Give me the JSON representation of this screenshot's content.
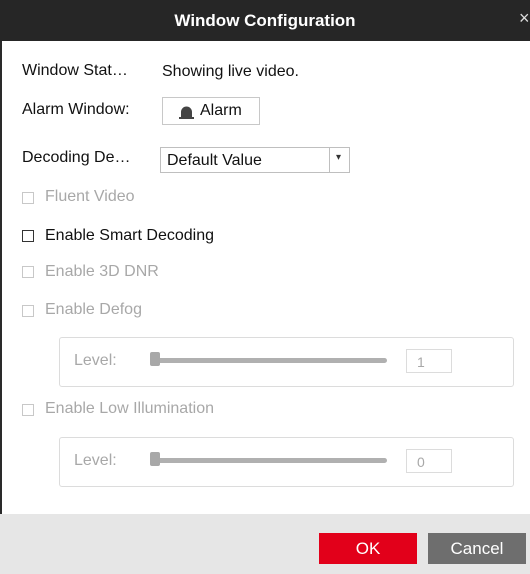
{
  "dialog": {
    "title": "Window Configuration",
    "close_symbol": "×"
  },
  "window_status": {
    "label": "Window Stat…",
    "value": "Showing live video."
  },
  "alarm_window": {
    "label": "Alarm Window:",
    "button_label": "Alarm",
    "icon": "alarm-light-icon"
  },
  "decoding": {
    "label": "Decoding De…",
    "selected": "Default Value",
    "arrow": "▾"
  },
  "options": {
    "fluent_video": {
      "label": "Fluent Video",
      "checked": false,
      "enabled": false
    },
    "smart_decoding": {
      "label": "Enable Smart Decoding",
      "checked": false,
      "enabled": true
    },
    "dnr_3d": {
      "label": "Enable 3D DNR",
      "checked": false,
      "enabled": false
    },
    "defog": {
      "label": "Enable Defog",
      "checked": false,
      "enabled": false
    },
    "low_illumination": {
      "label": "Enable Low Illumination",
      "checked": false,
      "enabled": false
    }
  },
  "defog_level": {
    "label": "Level:",
    "value": "1",
    "slider_fraction": 0.01
  },
  "low_illum_level": {
    "label": "Level:",
    "value": "0",
    "slider_fraction": 0.0
  },
  "footer": {
    "ok_label": "OK",
    "cancel_label": "Cancel"
  },
  "colors": {
    "titlebar": "#262626",
    "ok_button": "#e2001a",
    "cancel_button": "#6e6e6e",
    "footer": "#e6e6e6",
    "disabled_text": "#a8a8a8"
  }
}
